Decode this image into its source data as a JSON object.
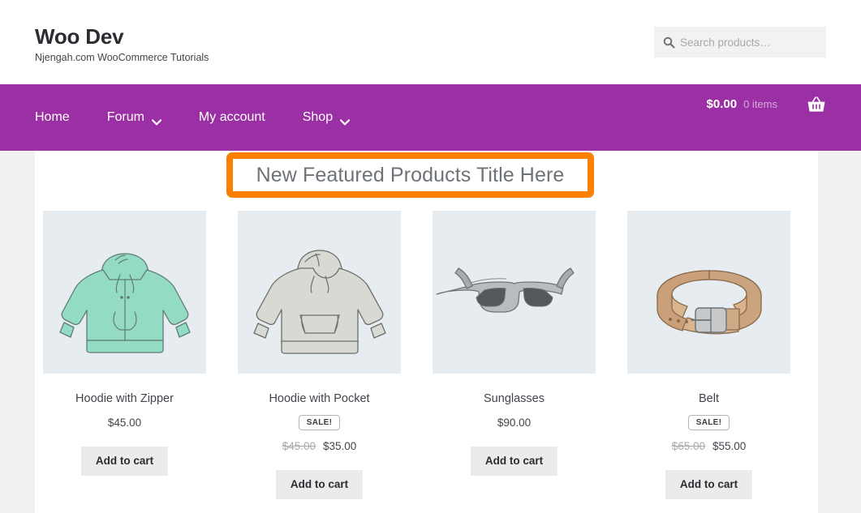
{
  "header": {
    "site_title": "Woo Dev",
    "tagline": "Njengah.com WooCommerce Tutorials",
    "search": {
      "placeholder": "Search products…",
      "value": "",
      "icon": "search-icon"
    }
  },
  "nav": {
    "items": [
      {
        "label": "Home",
        "has_dropdown": false
      },
      {
        "label": "Forum",
        "has_dropdown": true
      },
      {
        "label": "My account",
        "has_dropdown": false
      },
      {
        "label": "Shop",
        "has_dropdown": true
      }
    ],
    "cart": {
      "amount": "$0.00",
      "count": "0 items",
      "icon": "shopping-basket-icon"
    },
    "background_color": "#9b30a5"
  },
  "main": {
    "featured_title": "New Featured Products Title Here",
    "highlight_color": "#fa8000",
    "products": [
      {
        "name": "Hoodie with Zipper",
        "image": "mint-zip-hoodie",
        "on_sale": false,
        "sale_label": "",
        "price": "$45.00",
        "price_old": "",
        "add_to_cart_label": "Add to cart"
      },
      {
        "name": "Hoodie with Pocket",
        "image": "gray-pullover-hoodie",
        "on_sale": true,
        "sale_label": "SALE!",
        "price": "$35.00",
        "price_old": "$45.00",
        "add_to_cart_label": "Add to cart"
      },
      {
        "name": "Sunglasses",
        "image": "gray-sunglasses",
        "on_sale": false,
        "sale_label": "",
        "price": "$90.00",
        "price_old": "",
        "add_to_cart_label": "Add to cart"
      },
      {
        "name": "Belt",
        "image": "tan-leather-belt",
        "on_sale": true,
        "sale_label": "SALE!",
        "price": "$55.00",
        "price_old": "$65.00",
        "add_to_cart_label": "Add to cart"
      }
    ]
  }
}
